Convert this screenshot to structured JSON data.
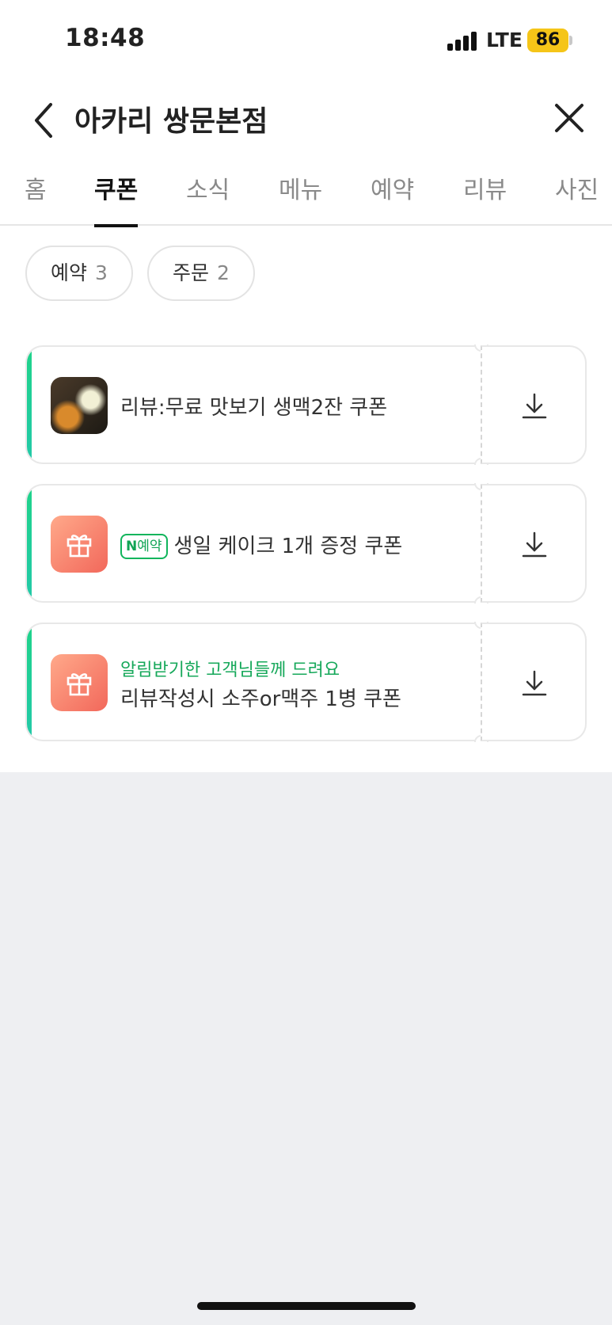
{
  "status_bar": {
    "time": "18:48",
    "network": "LTE",
    "battery": "86"
  },
  "header": {
    "title": "아카리 쌍문본점"
  },
  "tabs": [
    {
      "label": "홈",
      "active": false
    },
    {
      "label": "쿠폰",
      "active": true
    },
    {
      "label": "소식",
      "active": false
    },
    {
      "label": "메뉴",
      "active": false
    },
    {
      "label": "예약",
      "active": false
    },
    {
      "label": "리뷰",
      "active": false
    },
    {
      "label": "사진",
      "active": false
    }
  ],
  "filters": [
    {
      "label": "예약",
      "count": "3"
    },
    {
      "label": "주문",
      "count": "2"
    }
  ],
  "coupons": [
    {
      "thumb": "food-photo",
      "title": "리뷰:무료 맛보기 생맥2잔 쿠폰",
      "subtitle": "",
      "badge": ""
    },
    {
      "thumb": "gift-icon",
      "title": "생일 케이크 1개 증정 쿠폰",
      "subtitle": "",
      "badge_n": "N",
      "badge_text": "예약"
    },
    {
      "thumb": "gift-icon",
      "title": "리뷰작성시 소주or맥주 1병 쿠폰",
      "subtitle": "알림받기한 고객님들께 드려요",
      "badge": ""
    }
  ],
  "colors": {
    "accent_green": "#1fd38a",
    "gift_gradient_start": "#ffa98a",
    "gift_gradient_end": "#f2685b",
    "battery": "#f5c518"
  }
}
